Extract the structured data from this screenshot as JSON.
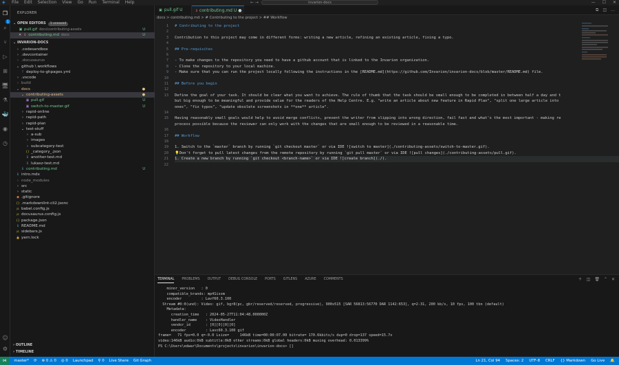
{
  "titlebar": {
    "menu": [
      "File",
      "Edit",
      "Selection",
      "View",
      "Go",
      "Run",
      "Terminal",
      "Help"
    ],
    "search": "invarion-docs",
    "nav_back": "←",
    "nav_fwd": "→"
  },
  "activity": {
    "icons": [
      "files-icon",
      "search-icon",
      "source-control-icon",
      "run-debug-icon",
      "extensions-icon",
      "remote-explorer-icon",
      "testing-icon",
      "docker-icon",
      "github-icon",
      "timeline-icon"
    ],
    "badge": "1"
  },
  "sidebar": {
    "title": "EXPLORER",
    "open_editors": {
      "label": "OPEN EDITORS",
      "badge": "1 unsaved",
      "items": [
        {
          "name": "pull.gif",
          "path": "docs\\contributing-assets",
          "status": "U"
        },
        {
          "name": "contributing.md",
          "path": "docs",
          "status": "U"
        }
      ]
    },
    "workspace": "INVARION-DOCS",
    "tree": [
      {
        "label": ".codesandbox",
        "kind": "folder"
      },
      {
        "label": ".devcontainer",
        "kind": "folder"
      },
      {
        "label": ".docusaurus",
        "kind": "folder",
        "dim": true
      },
      {
        "label": "github \\ workflows",
        "kind": "folder"
      },
      {
        "label": "deploy-to-ghpages.yml",
        "kind": "file"
      },
      {
        "label": ".vscode",
        "kind": "folder"
      },
      {
        "label": "build",
        "kind": "folder",
        "dim": true
      },
      {
        "label": "docs",
        "kind": "folder",
        "status": "●"
      },
      {
        "label": "contributing-assets",
        "kind": "folder",
        "status": "●"
      },
      {
        "label": "pull.gif",
        "kind": "file",
        "status": "U"
      },
      {
        "label": "switch-to-master.gif",
        "kind": "file",
        "status": "U"
      },
      {
        "label": "rapid-online",
        "kind": "folder"
      },
      {
        "label": "rapid-path",
        "kind": "folder"
      },
      {
        "label": "rapid-plan",
        "kind": "folder"
      },
      {
        "label": "test-stuff",
        "kind": "folder"
      },
      {
        "label": "a-sub",
        "kind": "folder"
      },
      {
        "label": "images",
        "kind": "folder"
      },
      {
        "label": "subcategory-test",
        "kind": "folder"
      },
      {
        "label": "_category_.json",
        "kind": "file"
      },
      {
        "label": "another-test.md",
        "kind": "file"
      },
      {
        "label": "lukasz-test.md",
        "kind": "file"
      },
      {
        "label": "contributing.md",
        "kind": "file",
        "status": "U"
      },
      {
        "label": "intro.mdx",
        "kind": "file"
      },
      {
        "label": "node_modules",
        "kind": "folder",
        "dim": true
      },
      {
        "label": "src",
        "kind": "folder"
      },
      {
        "label": "static",
        "kind": "folder"
      },
      {
        "label": ".gitignore",
        "kind": "file"
      },
      {
        "label": ".markdownlint-cli2.jsonc",
        "kind": "file"
      },
      {
        "label": "babel.config.js",
        "kind": "file"
      },
      {
        "label": "docusaurus.config.js",
        "kind": "file"
      },
      {
        "label": "package.json",
        "kind": "file"
      },
      {
        "label": "README.md",
        "kind": "file"
      },
      {
        "label": "sidebars.js",
        "kind": "file"
      },
      {
        "label": "yarn.lock",
        "kind": "file"
      }
    ],
    "outline": "OUTLINE",
    "timeline": "TIMELINE"
  },
  "tabs": [
    {
      "name": "pull.gif",
      "status": "U"
    },
    {
      "name": "contributing.md",
      "status": "U"
    }
  ],
  "breadcrumbs": "docs  >  contributing.md  >  # Contributing to the project  >  ## Workflow",
  "editor": {
    "lines": [
      {
        "n": "1",
        "t": "# Contributing to the project",
        "c": "h"
      },
      {
        "n": "2",
        "t": "",
        "c": ""
      },
      {
        "n": "3",
        "t": "Contribution to this project may come in different forms: writing a new article, refining an existing article, fixing a typo.",
        "c": ""
      },
      {
        "n": "4",
        "t": "",
        "c": ""
      },
      {
        "n": "5",
        "t": "## Pre-requisites",
        "c": "h"
      },
      {
        "n": "6",
        "t": "",
        "c": ""
      },
      {
        "n": "7",
        "t": "- To make changes to the repository you need to have a github account that is linked to the Invarion organization.",
        "c": ""
      },
      {
        "n": "8",
        "t": "- Clone the repository to your local machine.",
        "c": ""
      },
      {
        "n": "9",
        "t": "- Make sure that you can run the project locally following the instructions in the [README.md](https://github.com/Invarion/invarion-docs/blob/master/README.md) file.",
        "c": "lk"
      },
      {
        "n": "10",
        "t": "",
        "c": ""
      },
      {
        "n": "11",
        "t": "## Before you begin",
        "c": "h"
      },
      {
        "n": "12",
        "t": "",
        "c": ""
      },
      {
        "n": "13",
        "t": "Define the goal of your task. It should be clear what you want to achieve. The rule of thumb that the task should be small enough to be completed in between half a day and t",
        "c": ""
      },
      {
        "n": "",
        "t": "but big enough to be meaningful and provide value for the readers of the Help Centre. E.g. \"write an article about new feature in Rapid Plan\", \"split one large article into",
        "c": ""
      },
      {
        "n": "",
        "t": "ones\", \"fix typos\", \"update obsolete screenshots in **one** article\".",
        "c": ""
      },
      {
        "n": "14",
        "t": "",
        "c": ""
      },
      {
        "n": "15",
        "t": "Having reasonably small goals would help to avoid merge conflicts, prevent the writer from slipping into wrong direction, fail fast and what's the most important - making re",
        "c": ""
      },
      {
        "n": "",
        "t": "process possible because the reviewer can only work with the changes that are small enough to be reviewed in a reasonable time.",
        "c": ""
      },
      {
        "n": "16",
        "t": "",
        "c": ""
      },
      {
        "n": "17",
        "t": "## Workflow",
        "c": "h"
      },
      {
        "n": "18",
        "t": "",
        "c": ""
      },
      {
        "n": "19",
        "t": "1. Switch to the `master` branch by running `git checkout master` or via IDE ![switch to master](./contributing-assets/switch-to-master.gif).",
        "c": "lk"
      },
      {
        "n": "20",
        "t": "💡Don't forget to pull latest changes from the remote repository by running `git pull master` or via IDE ![pull changes](./contributing-assets/pull.gif).",
        "c": "lk"
      },
      {
        "n": "21",
        "t": "1. Create a new branch by running `git checkout <branch-name>` or via IDE ![create branch](./).",
        "c": "lk"
      },
      {
        "n": "22",
        "t": "",
        "c": ""
      }
    ]
  },
  "panel": {
    "tabs": [
      "TERMINAL",
      "PROBLEMS",
      "OUTPUT",
      "DEBUG CONSOLE",
      "PORTS",
      "GITLENS",
      "AZURE",
      "COMMENTS"
    ],
    "terminal": [
      "    minor_version   : 0",
      "    compatible_brands: mp41isom",
      "    encoder         : Lavf60.3.100",
      "  Stream #0:0(und): Video: gif, bgr8(pc, gbr/reserved/reserved, progressive), 900x515 [SAR 56813:56770 DAR 1142:653], q=2-31, 200 kb/s, 10 fps, 100 tbn (default)",
      "    Metadata:",
      "      creation_time   : 2024-05-27T11:04:48.000000Z",
      "      handler_name    : VideoHandler",
      "      vendor_id       : [0][0][0][0]",
      "      encoder         : Lavc60.3.100 gif",
      "frame=   71 fps=0.0 q=-0.0 Lsize=     146kB time=00:00:07.00 bitrate= 170.6kbits/s dup=0 drop=137 speed=15.7x",
      "video:146kB audio:0kB subtitle:0kB other streams:0kB global headers:0kB muxing overhead: 0.013399%",
      "PS C:\\Users\\edwar\\Documents\\projects\\invarion\\invarion-docs> []"
    ]
  },
  "statusbar": {
    "left": [
      "master*",
      "⟳",
      "⊗ 0 ⚠ 0",
      "◎ 0",
      "Launchpad",
      "⚲ 0",
      "Live Share",
      "Git Graph"
    ],
    "right": [
      "Ln 21, Col 94",
      "Spaces: 2",
      "UTF-8",
      "CRLF",
      "{} Markdown",
      "Go Live",
      "🔔"
    ]
  },
  "colors": {
    "accent": "#0078d4",
    "untracked": "#73c991",
    "modified": "#e2c08d"
  }
}
